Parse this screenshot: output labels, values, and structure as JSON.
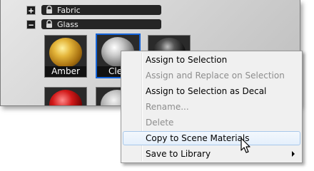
{
  "categories": [
    {
      "toggle": "+",
      "label": "Fabric"
    },
    {
      "toggle": "−",
      "label": "Glass"
    }
  ],
  "materials": [
    {
      "label": "Amber",
      "selected": false
    },
    {
      "label": "Cle",
      "selected": true
    },
    {
      "label": "",
      "selected": false
    }
  ],
  "context_menu": {
    "items": [
      {
        "label": "Assign to Selection",
        "enabled": true
      },
      {
        "label": "Assign and Replace on Selection",
        "enabled": false
      },
      {
        "label": "Assign to Selection as Decal",
        "enabled": true
      },
      {
        "label": "Rename...",
        "enabled": false
      },
      {
        "label": "Delete",
        "enabled": false
      },
      {
        "label": "Copy to Scene Materials",
        "enabled": true,
        "hovered": true
      },
      {
        "label": "Save to Library",
        "enabled": true,
        "submenu": true
      }
    ]
  },
  "colors": {
    "selection_accent": "#1463d8",
    "menu_hover": "#e4effb",
    "disabled_text": "#8d8d8d"
  },
  "icons": [
    "lock-icon",
    "submenu-arrow-icon",
    "mouse-cursor-icon"
  ]
}
